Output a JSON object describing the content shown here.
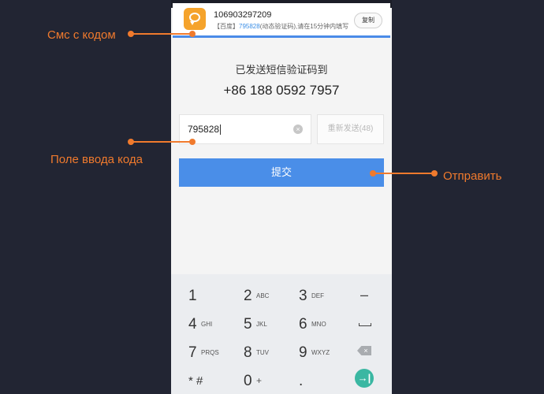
{
  "notification": {
    "sender": "106903297209",
    "prefix": "【百度】",
    "code": "795828",
    "suffix": "(动态验证码),请在15分钟内填写",
    "copy_label": "复制"
  },
  "verify": {
    "sent_label": "已发送短信验证码到",
    "phone_number": "+86 188 0592 7957",
    "code_value": "795828",
    "resend_label": "重新发送(48)",
    "submit_label": "提交",
    "clear_glyph": "×"
  },
  "keyboard": {
    "keys": [
      {
        "num": "1",
        "letters": ""
      },
      {
        "num": "2",
        "letters": "ABC"
      },
      {
        "num": "3",
        "letters": "DEF"
      },
      {
        "num": "4",
        "letters": "GHI"
      },
      {
        "num": "5",
        "letters": "JKL"
      },
      {
        "num": "6",
        "letters": "MNO"
      },
      {
        "num": "7",
        "letters": "PRQS"
      },
      {
        "num": "8",
        "letters": "TUV"
      },
      {
        "num": "9",
        "letters": "WXYZ"
      },
      {
        "num": "* #",
        "letters": ""
      },
      {
        "num": "0",
        "letters": "+"
      },
      {
        "num": ".",
        "letters": ""
      }
    ],
    "minus": "–",
    "enter_glyph": "→|"
  },
  "annotations": {
    "sms": "Смс с кодом",
    "code_field": "Поле ввода кода",
    "submit": "Отправить"
  },
  "icons": [
    "message-app-icon",
    "clear-icon",
    "space-icon",
    "backspace-icon",
    "enter-icon"
  ],
  "colors": {
    "accent": "#4a8ee8",
    "annotation": "#f07a2d",
    "background": "#222533"
  }
}
